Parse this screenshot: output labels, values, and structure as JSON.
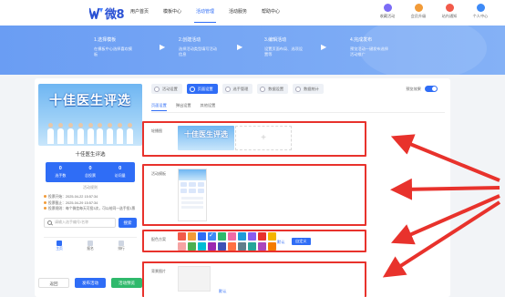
{
  "brand": {
    "name": "微8",
    "color": "#2b52d4"
  },
  "nav": {
    "items": [
      {
        "label": "用户首页",
        "active": false
      },
      {
        "label": "模板中心",
        "active": false
      },
      {
        "label": "活动管理",
        "active": true
      },
      {
        "label": "活动服务",
        "active": false
      },
      {
        "label": "帮助中心",
        "active": false
      }
    ]
  },
  "tools": [
    {
      "label": "收藏活动",
      "icon": "star-icon",
      "color": "#7b6cf6"
    },
    {
      "label": "会员升级",
      "icon": "crown-icon",
      "color": "#f29b38"
    },
    {
      "label": "站内通知",
      "icon": "bell-icon",
      "color": "#f25a4a"
    },
    {
      "label": "个人中心",
      "icon": "user-icon",
      "color": "#3d8af7"
    }
  ],
  "steps": [
    {
      "title": "1.选择模板",
      "desc": "在模板中心选择喜欢模板"
    },
    {
      "title": "2.创建活动",
      "desc": "选择活动类型填写活动信息"
    },
    {
      "title": "3.编辑活动",
      "desc": "设置页面布局、选项设置等"
    },
    {
      "title": "4.完成发布",
      "desc": "预览活动一键发布选择活动推广"
    }
  ],
  "preview": {
    "poster_title": "十佳医生评选",
    "poster_sub": "",
    "activity_name": "十佳医生评选",
    "stats": [
      {
        "value": "0",
        "label": "选手数"
      },
      {
        "value": "0",
        "label": "总投票"
      },
      {
        "value": "0",
        "label": "访问量"
      }
    ],
    "rules_link": "活动规则",
    "info": [
      "投票开始：2025-04-22 15:57:34",
      "投票截止：2025-04-29 15:57:34",
      "投票规则：每个微信每天可投3次，可以给同一选手投1票"
    ],
    "search_placeholder": "请输入选手编号/名称",
    "search_button": "搜索",
    "tabbar": [
      {
        "label": "主页",
        "active": true
      },
      {
        "label": "报名",
        "active": false
      },
      {
        "label": "排行",
        "active": false
      }
    ],
    "actions": {
      "back": "返回",
      "publish": "发布活动",
      "preview": "活动预览"
    }
  },
  "editor": {
    "tabs": [
      {
        "label": "活动设置",
        "active": false
      },
      {
        "label": "页面设置",
        "active": true
      },
      {
        "label": "选手管理",
        "active": false
      },
      {
        "label": "数据设置",
        "active": false
      },
      {
        "label": "数据统计",
        "active": false
      }
    ],
    "toggle_label": "预览效果",
    "subtabs": [
      {
        "label": "页面设置",
        "active": true
      },
      {
        "label": "弹出设置",
        "active": false
      },
      {
        "label": "其他设置",
        "active": false
      }
    ],
    "sections": {
      "banner_label": "轮播图",
      "banner_thumb_text": "十佳医生评选",
      "add_symbol": "+",
      "template_label": "活动模板",
      "color_label": "配色方案",
      "color_default": "默认",
      "color_custom": "自定义",
      "bg_label": "背景图片",
      "bg_default": "默认"
    },
    "swatch_colors": [
      "#f25a4a",
      "#f29b38",
      "#2f6df6",
      "#3d8af7",
      "#2fb96c",
      "#f06ba6",
      "#1f9bd8",
      "#8a5cf0",
      "#e8322c",
      "#f4b400",
      "#f5a3a3",
      "#4caf50",
      "#00bcd4",
      "#9c27b0",
      "#3f51b5",
      "#ff7043",
      "#607d8b",
      "#26a69a",
      "#ab47bc",
      "#f57c00"
    ],
    "selected_swatch": 3
  }
}
